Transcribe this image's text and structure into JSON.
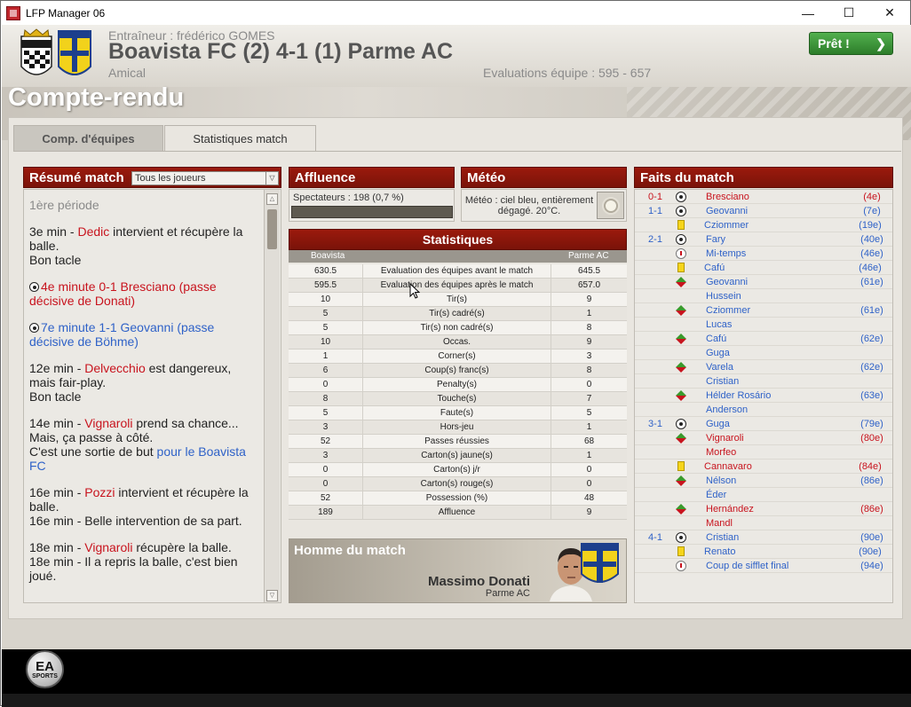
{
  "window": {
    "title": "LFP Manager 06",
    "minimize": "—",
    "maximize": "☐",
    "close": "✕"
  },
  "header": {
    "coach": "Entraîneur : frédérico GOMES",
    "match": "Boavista FC (2) 4-1 (1) Parme AC",
    "type": "Amical",
    "evaluations": "Evaluations équipe : 595 - 657",
    "ready_label": "Prêt !"
  },
  "section_title": "Compte-rendu",
  "tabs": [
    {
      "label": "Comp. d'équipes"
    },
    {
      "label": "Statistiques match"
    }
  ],
  "resume": {
    "title": "Résumé match",
    "filter": "Tous les joueurs",
    "period": "1ère période",
    "e1": {
      "t1": "3e min - ",
      "r1": "Dedic",
      "t2": " intervient et récupère la balle.",
      "t3": "Bon tacle"
    },
    "e2": {
      "r1": "4e minute  0-1 Bresciano (passe décisive de Donati)"
    },
    "e3": {
      "b1": "7e minute  1-1 Geovanni (passe décisive de Böhme)"
    },
    "e4": {
      "t1": "12e min - ",
      "r1": "Delvecchio",
      "t2": " est dangereux, mais fair-play.",
      "t3": "Bon tacle"
    },
    "e5": {
      "t1": "14e min - ",
      "r1": "Vignaroli",
      "t2": " prend sa chance...",
      "t3": "Mais, ça passe à côté.",
      "t4": "C'est une sortie de but ",
      "b1": "pour le Boavista FC"
    },
    "e6": {
      "t1": "16e min - ",
      "r1": "Pozzi",
      "t2": " intervient et récupère la balle.",
      "t3": "16e min - Belle intervention de sa part."
    },
    "e7": {
      "t1": "18e min - ",
      "r1": "Vignaroli",
      "t2": " récupère la balle.",
      "t3": "18e min - Il a repris la balle, c'est bien joué."
    }
  },
  "affluence": {
    "title": "Affluence",
    "text": "Spectateurs : 198 (0,7 %)"
  },
  "meteo": {
    "title": "Météo",
    "text": "Météo : ciel bleu, entièrement dégagé. 20°C."
  },
  "stats": {
    "title": "Statistiques",
    "home": "Boavista",
    "away": "Parme AC",
    "rows": [
      {
        "a": "630.5",
        "l": "Evaluation des équipes avant le match",
        "b": "645.5"
      },
      {
        "a": "595.5",
        "l": "Evaluation des équipes après le match",
        "b": "657.0"
      },
      {
        "a": "10",
        "l": "Tir(s)",
        "b": "9"
      },
      {
        "a": "5",
        "l": "Tir(s) cadré(s)",
        "b": "1"
      },
      {
        "a": "5",
        "l": "Tir(s) non cadré(s)",
        "b": "8"
      },
      {
        "a": "10",
        "l": "Occas.",
        "b": "9"
      },
      {
        "a": "1",
        "l": "Corner(s)",
        "b": "3"
      },
      {
        "a": "6",
        "l": "Coup(s) franc(s)",
        "b": "8"
      },
      {
        "a": "0",
        "l": "Penalty(s)",
        "b": "0"
      },
      {
        "a": "8",
        "l": "Touche(s)",
        "b": "7"
      },
      {
        "a": "5",
        "l": "Faute(s)",
        "b": "5"
      },
      {
        "a": "3",
        "l": "Hors-jeu",
        "b": "1"
      },
      {
        "a": "52",
        "l": "Passes réussies",
        "b": "68"
      },
      {
        "a": "3",
        "l": "Carton(s) jaune(s)",
        "b": "1"
      },
      {
        "a": "0",
        "l": "Carton(s) j/r",
        "b": "0"
      },
      {
        "a": "0",
        "l": "Carton(s) rouge(s)",
        "b": "0"
      },
      {
        "a": "52",
        "l": "Possession (%)",
        "b": "48"
      },
      {
        "a": "189",
        "l": "Affluence",
        "b": "9"
      }
    ]
  },
  "motm": {
    "title": "Homme du match",
    "name": "Massimo Donati",
    "club": "Parme AC"
  },
  "faits": {
    "title": "Faits du match",
    "rows": [
      {
        "score": "0-1",
        "icon": "ball",
        "player": "Bresciano",
        "minute": "(4e)",
        "team": "red"
      },
      {
        "score": "1-1",
        "icon": "ball",
        "player": "Geovanni",
        "minute": "(7e)",
        "team": "blue"
      },
      {
        "score": "",
        "icon": "yellow",
        "player": "Cziommer",
        "minute": "(19e)",
        "team": "blue"
      },
      {
        "score": "2-1",
        "icon": "ball",
        "player": "Fary",
        "minute": "(40e)",
        "team": "blue"
      },
      {
        "score": "",
        "icon": "whistle",
        "player": "Mi-temps",
        "minute": "(46e)",
        "team": "blue"
      },
      {
        "score": "",
        "icon": "yellow",
        "player": "Cafú",
        "minute": "(46e)",
        "team": "blue"
      },
      {
        "score": "",
        "icon": "sub",
        "player": "Geovanni",
        "minute": "(61e)",
        "team": "blue"
      },
      {
        "score": "",
        "icon": "",
        "player": "Hussein",
        "minute": "",
        "team": "blue"
      },
      {
        "score": "",
        "icon": "sub",
        "player": "Cziommer",
        "minute": "(61e)",
        "team": "blue"
      },
      {
        "score": "",
        "icon": "",
        "player": "Lucas",
        "minute": "",
        "team": "blue"
      },
      {
        "score": "",
        "icon": "sub",
        "player": "Cafú",
        "minute": "(62e)",
        "team": "blue"
      },
      {
        "score": "",
        "icon": "",
        "player": "Guga",
        "minute": "",
        "team": "blue"
      },
      {
        "score": "",
        "icon": "sub",
        "player": "Varela",
        "minute": "(62e)",
        "team": "blue"
      },
      {
        "score": "",
        "icon": "",
        "player": "Cristian",
        "minute": "",
        "team": "blue"
      },
      {
        "score": "",
        "icon": "sub",
        "player": "Hélder Rosário",
        "minute": "(63e)",
        "team": "blue"
      },
      {
        "score": "",
        "icon": "",
        "player": "Anderson",
        "minute": "",
        "team": "blue"
      },
      {
        "score": "3-1",
        "icon": "ball",
        "player": "Guga",
        "minute": "(79e)",
        "team": "blue"
      },
      {
        "score": "",
        "icon": "sub",
        "player": "Vignaroli",
        "minute": "(80e)",
        "team": "red"
      },
      {
        "score": "",
        "icon": "",
        "player": "Morfeo",
        "minute": "",
        "team": "red"
      },
      {
        "score": "",
        "icon": "yellow",
        "player": "Cannavaro",
        "minute": "(84e)",
        "team": "red"
      },
      {
        "score": "",
        "icon": "sub",
        "player": "Nélson",
        "minute": "(86e)",
        "team": "blue"
      },
      {
        "score": "",
        "icon": "",
        "player": "Éder",
        "minute": "",
        "team": "blue"
      },
      {
        "score": "",
        "icon": "sub",
        "player": "Hernández",
        "minute": "(86e)",
        "team": "red"
      },
      {
        "score": "",
        "icon": "",
        "player": "Mandl",
        "minute": "",
        "team": "red"
      },
      {
        "score": "4-1",
        "icon": "ball",
        "player": "Cristian",
        "minute": "(90e)",
        "team": "blue"
      },
      {
        "score": "",
        "icon": "yellow",
        "player": "Renato",
        "minute": "(90e)",
        "team": "blue"
      },
      {
        "score": "",
        "icon": "whistle",
        "player": "Coup de sifflet final",
        "minute": "(94e)",
        "team": "blue"
      }
    ]
  },
  "footer": {
    "ea": "EA",
    "sports": "SPORTS"
  },
  "colors": {
    "panel_red": "#8a150a",
    "ready_green": "#3f973b",
    "home_blue": "#2f62c8",
    "away_red": "#c8141e"
  }
}
